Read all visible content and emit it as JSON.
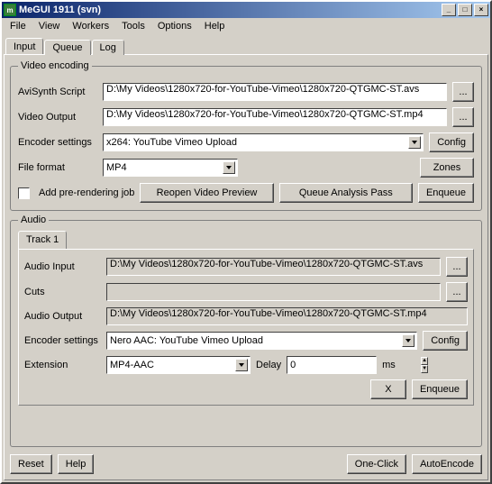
{
  "window": {
    "title": "MeGUI 1911 (svn)"
  },
  "menu": {
    "file": "File",
    "view": "View",
    "workers": "Workers",
    "tools": "Tools",
    "options": "Options",
    "help": "Help"
  },
  "tabs": {
    "input": "Input",
    "queue": "Queue",
    "log": "Log"
  },
  "video": {
    "legend": "Video encoding",
    "script_label": "AviSynth Script",
    "script_value": "D:\\My Videos\\1280x720-for-YouTube-Vimeo\\1280x720-QTGMC-ST.avs",
    "output_label": "Video Output",
    "output_value": "D:\\My Videos\\1280x720-for-YouTube-Vimeo\\1280x720-QTGMC-ST.mp4",
    "encoder_label": "Encoder settings",
    "encoder_value": "x264: YouTube Vimeo Upload",
    "config_btn": "Config",
    "format_label": "File format",
    "format_value": "MP4",
    "zones_btn": "Zones",
    "prerender_label": "Add pre-rendering job",
    "reopen_btn": "Reopen Video Preview",
    "analysis_btn": "Queue Analysis Pass",
    "enqueue_btn": "Enqueue",
    "browse_btn": "..."
  },
  "audio": {
    "legend": "Audio",
    "track_tab": "Track 1",
    "input_label": "Audio Input",
    "input_value": "D:\\My Videos\\1280x720-for-YouTube-Vimeo\\1280x720-QTGMC-ST.avs",
    "cuts_label": "Cuts",
    "cuts_value": "",
    "output_label": "Audio Output",
    "output_value": "D:\\My Videos\\1280x720-for-YouTube-Vimeo\\1280x720-QTGMC-ST.mp4",
    "encoder_label": "Encoder settings",
    "encoder_value": "Nero AAC: YouTube Vimeo Upload",
    "config_btn": "Config",
    "ext_label": "Extension",
    "ext_value": "MP4-AAC",
    "delay_label": "Delay",
    "delay_value": "0",
    "delay_unit": "ms",
    "x_btn": "X",
    "enqueue_btn": "Enqueue",
    "browse_btn": "..."
  },
  "footer": {
    "reset": "Reset",
    "help": "Help",
    "oneclick": "One-Click",
    "autoencode": "AutoEncode"
  }
}
